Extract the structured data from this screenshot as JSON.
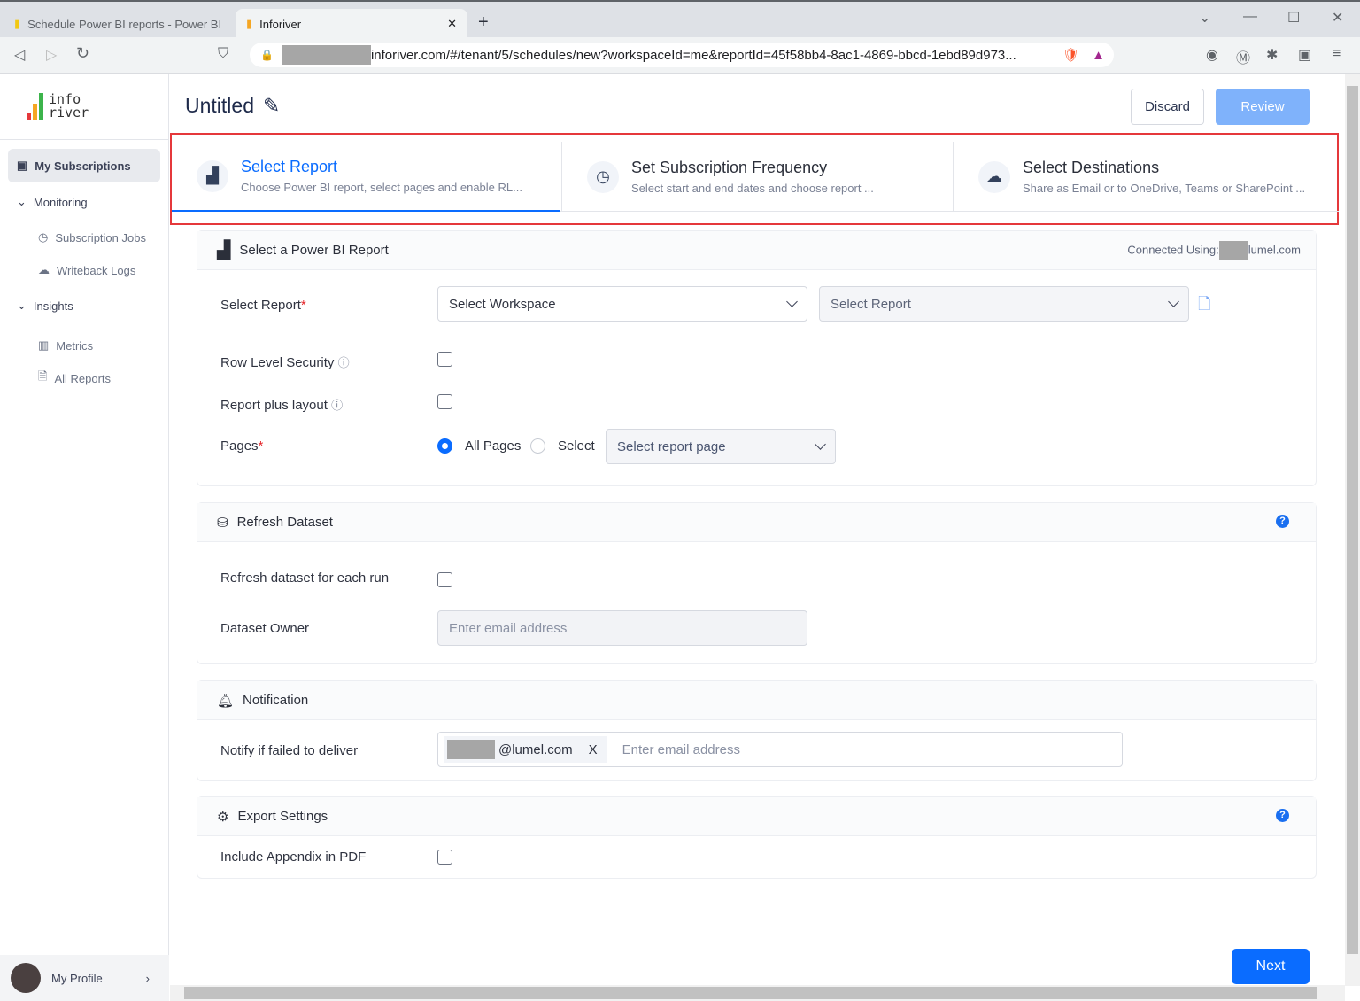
{
  "browser": {
    "tabs": [
      {
        "title": "Schedule Power BI reports - Power BI",
        "active": false
      },
      {
        "title": "Inforiver",
        "active": true
      }
    ],
    "url": "inforiver.com/#/tenant/5/schedules/new?workspaceId=me&reportId=45f58bb4-8ac1-4869-bbcd-1ebd89d973..."
  },
  "logo": {
    "line1": "info",
    "line2": "river"
  },
  "sidebar": {
    "items": [
      {
        "label": "My Subscriptions",
        "icon": "contact-card-icon",
        "active": true
      },
      {
        "label": "Monitoring",
        "icon": "chevron-down-icon"
      },
      {
        "label": "Subscription Jobs",
        "icon": "clock-icon"
      },
      {
        "label": "Writeback Logs",
        "icon": "cloud-upload-icon"
      },
      {
        "label": "Insights",
        "icon": "chevron-down-icon"
      },
      {
        "label": "Metrics",
        "icon": "chart-icon"
      },
      {
        "label": "All Reports",
        "icon": "document-icon"
      }
    ],
    "profile": "My Profile"
  },
  "header": {
    "title": "Untitled",
    "discard": "Discard",
    "review": "Review"
  },
  "steps": [
    {
      "title": "Select Report",
      "desc": "Choose Power BI report, select pages and enable RL...",
      "active": true
    },
    {
      "title": "Set Subscription Frequency",
      "desc": "Select start and end dates and choose report ..."
    },
    {
      "title": "Select Destinations",
      "desc": "Share as Email or to OneDrive, Teams or SharePoint ..."
    }
  ],
  "report": {
    "title": "Select a Power BI Report",
    "connected": "Connected Using:",
    "connected_domain": "lumel.com",
    "select_report_label": "Select Report",
    "required": "*",
    "workspace": "Select Workspace",
    "report_placeholder": "Select Report",
    "rls": "Row Level Security",
    "rls_checked": false,
    "layout": "Report plus layout",
    "layout_checked": false,
    "pages": "Pages",
    "all_pages": "All Pages",
    "select": "Select",
    "page_placeholder": "Select report page",
    "pages_mode": "All Pages"
  },
  "refresh": {
    "title": "Refresh Dataset",
    "each_run": "Refresh dataset for each run",
    "each_run_checked": false,
    "owner": "Dataset Owner",
    "owner_placeholder": "Enter email address",
    "help": "?"
  },
  "notification": {
    "title": "Notification",
    "label": "Notify if failed to deliver",
    "chip": "@lumel.com",
    "chip_remove": "X",
    "placeholder": "Enter email address"
  },
  "export": {
    "title": "Export Settings",
    "appendix": "Include Appendix in PDF",
    "appendix_checked": false,
    "help": "?"
  },
  "footer": {
    "next": "Next"
  },
  "colors": {
    "accent": "#0a6cff",
    "review_disabled": "#7fb2fb",
    "highlight": "#e5383b"
  }
}
